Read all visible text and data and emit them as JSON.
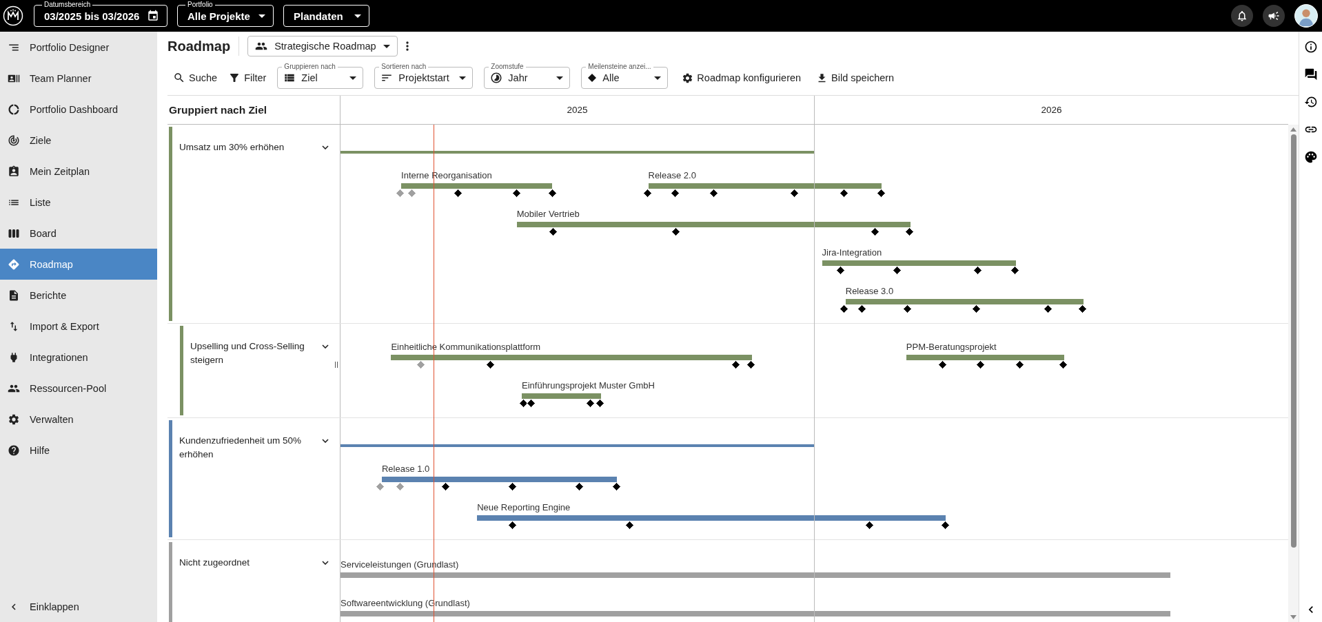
{
  "top_bar": {
    "date_range": {
      "label": "Datumsbereich",
      "value": "03/2025 bis 03/2026"
    },
    "portfolio": {
      "label": "Portfolio",
      "value": "Alle Projekte"
    },
    "data_source": {
      "value": "Plandaten"
    }
  },
  "sidebar": {
    "items": [
      {
        "label": "Portfolio Designer",
        "selected": false
      },
      {
        "label": "Team Planner",
        "selected": false
      },
      {
        "label": "Portfolio Dashboard",
        "selected": false
      },
      {
        "label": "Ziele",
        "selected": false
      },
      {
        "label": "Mein Zeitplan",
        "selected": false
      },
      {
        "label": "Liste",
        "selected": false
      },
      {
        "label": "Board",
        "selected": false
      },
      {
        "label": "Roadmap",
        "selected": true
      },
      {
        "label": "Berichte",
        "selected": false
      },
      {
        "label": "Import & Export",
        "selected": false
      },
      {
        "label": "Integrationen",
        "selected": false
      },
      {
        "label": "Ressourcen-Pool",
        "selected": false
      },
      {
        "label": "Verwalten",
        "selected": false
      },
      {
        "label": "Hilfe",
        "selected": false
      }
    ],
    "collapse_label": "Einklappen"
  },
  "page": {
    "title": "Roadmap",
    "view": "Strategische Roadmap"
  },
  "toolbar": {
    "buttons": [
      "Suche",
      "Filter"
    ],
    "selects": [
      {
        "label": "Gruppieren nach",
        "value": "Ziel"
      },
      {
        "label": "Sortieren nach",
        "value": "Projektstart"
      },
      {
        "label": "Zoomstufe",
        "value": "Jahr"
      },
      {
        "label": "Meilensteine anzei...",
        "value": "Alle"
      }
    ],
    "actions": [
      "Roadmap konfigurieren",
      "Bild speichern"
    ]
  },
  "roadmap": {
    "group_header": "Gruppiert nach Ziel",
    "years": [
      "2025",
      "2026"
    ],
    "groups": [
      {
        "title": "Umsatz um 30% erhöhen",
        "color": "#7b9163",
        "expanded": true,
        "lanes": [
          {
            "projects": [
              {
                "name": "Interne Reorganisation",
                "milestones": [
                  {
                    "reached": true
                  },
                  {
                    "reached": true
                  },
                  {
                    "reached": false
                  },
                  {
                    "reached": false
                  },
                  {
                    "reached": false
                  }
                ]
              },
              {
                "name": "Release 2.0",
                "milestones": [
                  {
                    "reached": false
                  },
                  {
                    "reached": false
                  },
                  {
                    "reached": false
                  },
                  {
                    "reached": false
                  },
                  {
                    "reached": false
                  },
                  {
                    "reached": false
                  }
                ]
              }
            ]
          },
          {
            "projects": [
              {
                "name": "Mobiler Vertrieb",
                "milestones": [
                  {
                    "reached": false
                  },
                  {
                    "reached": false
                  },
                  {
                    "reached": false
                  },
                  {
                    "reached": false
                  }
                ]
              }
            ]
          },
          {
            "projects": [
              {
                "name": "Jira-Integration",
                "milestones": [
                  {
                    "reached": false
                  },
                  {
                    "reached": false
                  },
                  {
                    "reached": false
                  },
                  {
                    "reached": false
                  }
                ]
              }
            ]
          },
          {
            "projects": [
              {
                "name": "Release 3.0",
                "milestones": [
                  {
                    "reached": false
                  },
                  {
                    "reached": false
                  },
                  {
                    "reached": false
                  },
                  {
                    "reached": false
                  },
                  {
                    "reached": false
                  },
                  {
                    "reached": false
                  }
                ]
              }
            ]
          }
        ],
        "children": [
          {
            "title": "Upselling und Cross-Selling steigern",
            "color": "#7b9163",
            "expanded": true,
            "lanes": [
              {
                "projects": [
                  {
                    "name": "Einheitliche Kommunikationsplattform",
                    "milestones": [
                      {
                        "reached": true
                      },
                      {
                        "reached": false
                      },
                      {
                        "reached": false
                      },
                      {
                        "reached": false
                      }
                    ]
                  },
                  {
                    "name": "PPM-Beratungsprojekt",
                    "milestones": [
                      {
                        "reached": false
                      },
                      {
                        "reached": false
                      },
                      {
                        "reached": false
                      },
                      {
                        "reached": false
                      }
                    ]
                  }
                ]
              },
              {
                "projects": [
                  {
                    "name": "Einführungsprojekt Muster GmbH",
                    "milestones": [
                      {
                        "reached": false
                      },
                      {
                        "reached": false
                      },
                      {
                        "reached": false
                      },
                      {
                        "reached": false
                      }
                    ]
                  }
                ]
              }
            ]
          }
        ]
      },
      {
        "title": "Kundenzufriedenheit um 50% erhöhen",
        "color": "#5b82b0",
        "expanded": true,
        "lanes": [
          {
            "projects": [
              {
                "name": "Release 1.0",
                "milestones": [
                  {
                    "reached": true
                  },
                  {
                    "reached": true
                  },
                  {
                    "reached": false
                  },
                  {
                    "reached": false
                  },
                  {
                    "reached": false
                  },
                  {
                    "reached": false
                  }
                ]
              }
            ]
          },
          {
            "projects": [
              {
                "name": "Neue Reporting Engine",
                "milestones": [
                  {
                    "reached": false
                  },
                  {
                    "reached": false
                  },
                  {
                    "reached": false
                  },
                  {
                    "reached": false
                  }
                ]
              }
            ]
          }
        ]
      },
      {
        "title": "Nicht zugeordnet",
        "color": "#a0a0a0",
        "expanded": true,
        "lanes": [
          {
            "projects": [
              {
                "name": "Serviceleistungen (Grundlast)"
              }
            ]
          },
          {
            "projects": [
              {
                "name": "Softwareentwicklung (Grundlast)"
              }
            ]
          }
        ]
      }
    ]
  }
}
